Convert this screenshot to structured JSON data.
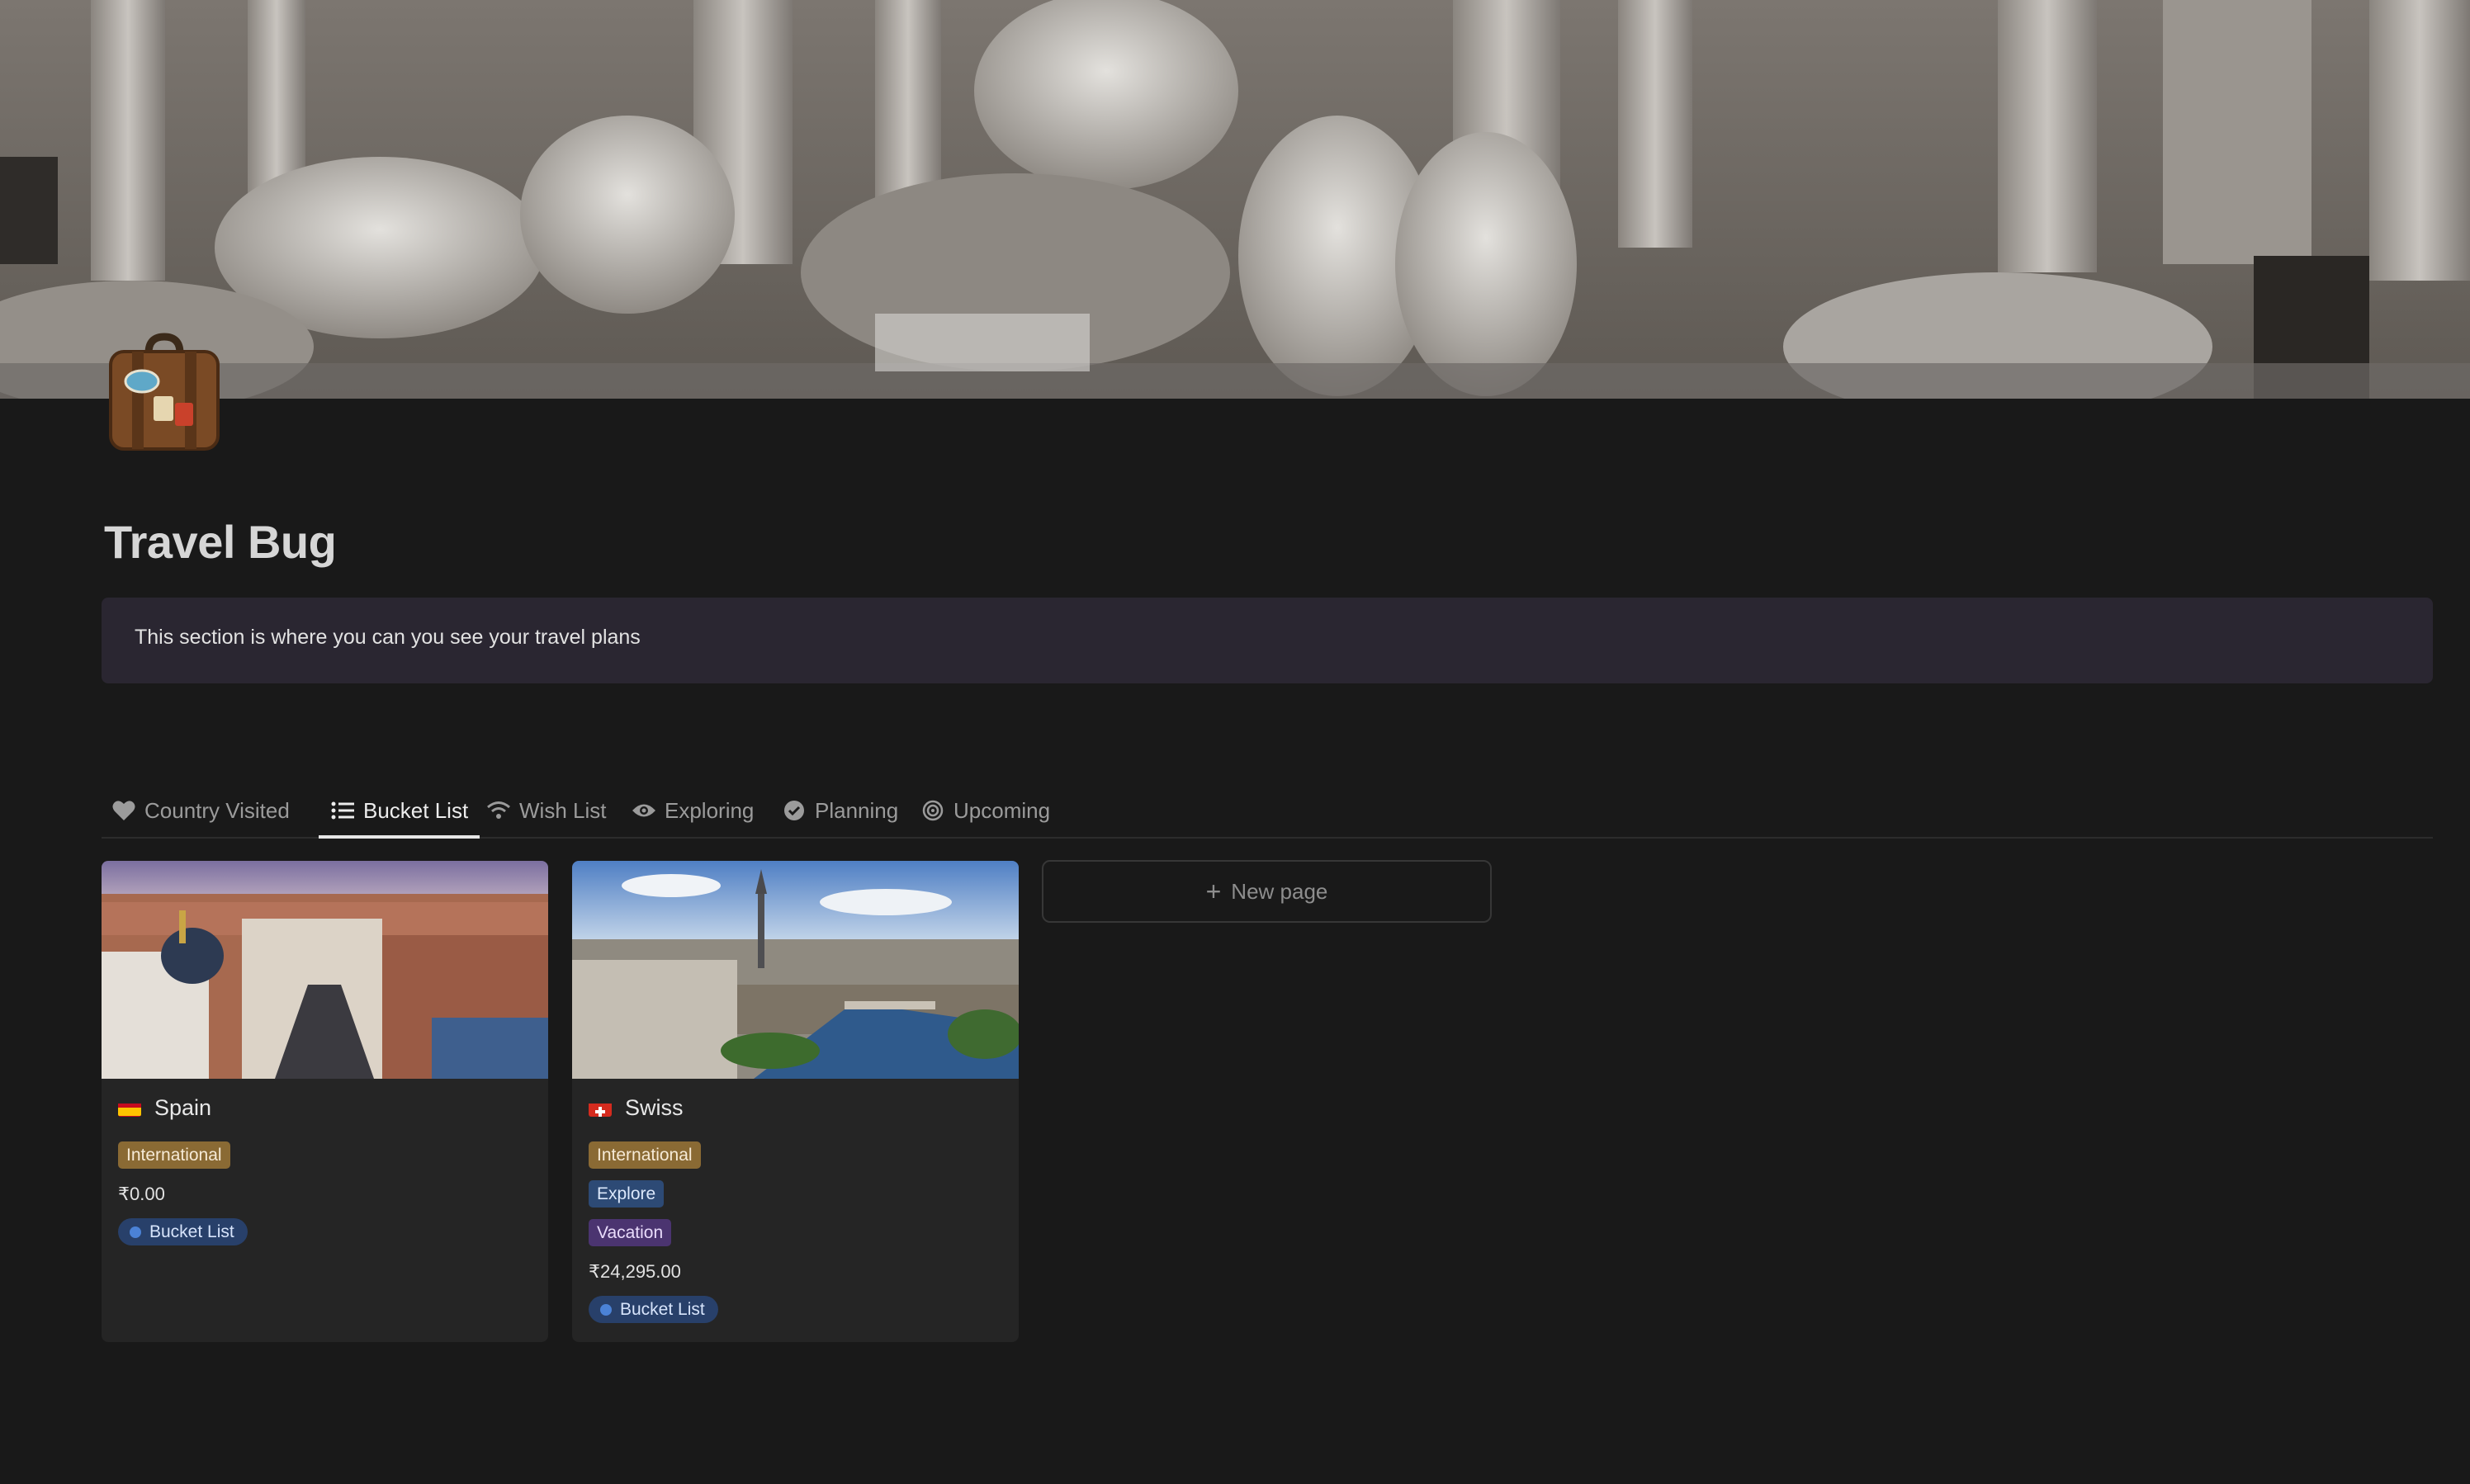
{
  "page": {
    "title": "Travel Bug",
    "callout": "This section is where you can you see your travel plans",
    "icon": "suitcase-icon"
  },
  "tabs": [
    {
      "label": "Country Visited",
      "icon": "heart-icon",
      "active": false
    },
    {
      "label": "Bucket List",
      "icon": "list-icon",
      "active": true
    },
    {
      "label": "Wish List",
      "icon": "wifi-icon",
      "active": false
    },
    {
      "label": "Exploring",
      "icon": "eye-icon",
      "active": false
    },
    {
      "label": "Planning",
      "icon": "check-circle-icon",
      "active": false
    },
    {
      "label": "Upcoming",
      "icon": "target-icon",
      "active": false
    }
  ],
  "cards": [
    {
      "title": "Spain",
      "flag": "spain-flag-icon",
      "tags": [
        "International"
      ],
      "price": "₹0.00",
      "status": "Bucket List"
    },
    {
      "title": "Swiss",
      "flag": "swiss-flag-icon",
      "tags": [
        "International",
        "Explore",
        "Vacation"
      ],
      "price": "₹24,295.00",
      "status": "Bucket List"
    }
  ],
  "new_page": {
    "label": "New page"
  },
  "colors": {
    "background": "#191919",
    "callout": "#2a2631",
    "card": "#252525",
    "tag_international": "#8a6a34",
    "tag_explore": "#2d4a75",
    "tag_vacation": "#4b3470",
    "status_bucket_list": "#28406a"
  }
}
